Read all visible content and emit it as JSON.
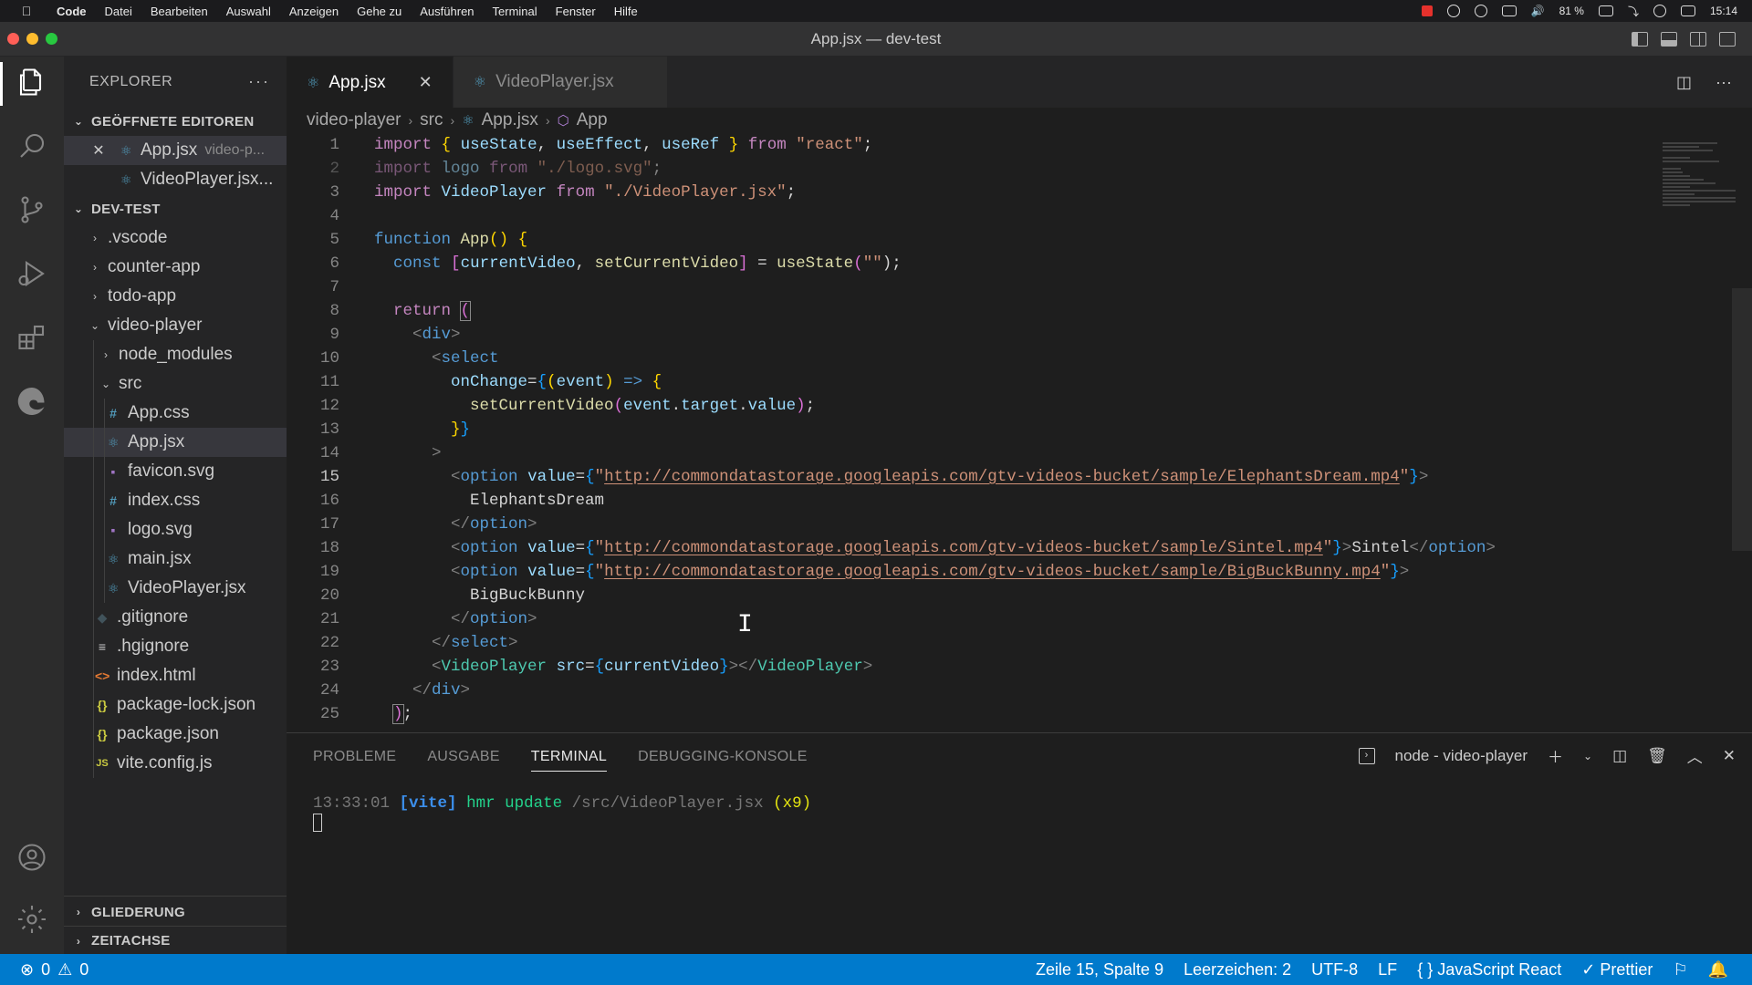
{
  "menubar": {
    "app": "Code",
    "items": [
      "Datei",
      "Bearbeiten",
      "Auswahl",
      "Anzeigen",
      "Gehe zu",
      "Ausführen",
      "Terminal",
      "Fenster",
      "Hilfe"
    ],
    "battery": "81 %",
    "clock": "15:14"
  },
  "window": {
    "title": "App.jsx — dev-test"
  },
  "sidebar": {
    "title": "EXPLORER",
    "open_editors_title": "GEÖFFNETE EDITOREN",
    "open_editors": [
      {
        "name": "App.jsx",
        "hint": "video-p..."
      },
      {
        "name": "VideoPlayer.jsx..."
      }
    ],
    "workspace_title": "DEV-TEST",
    "tree": [
      {
        "name": ".vscode",
        "kind": "folder"
      },
      {
        "name": "counter-app",
        "kind": "folder"
      },
      {
        "name": "todo-app",
        "kind": "folder"
      },
      {
        "name": "video-player",
        "kind": "folder-open"
      },
      {
        "name": "node_modules",
        "kind": "folder"
      },
      {
        "name": "src",
        "kind": "folder-open"
      },
      {
        "name": "App.css",
        "icon": "#"
      },
      {
        "name": "App.jsx",
        "icon": "⚛"
      },
      {
        "name": "favicon.svg",
        "icon": "▪"
      },
      {
        "name": "index.css",
        "icon": "#"
      },
      {
        "name": "logo.svg",
        "icon": "▪"
      },
      {
        "name": "main.jsx",
        "icon": "⚛"
      },
      {
        "name": "VideoPlayer.jsx",
        "icon": "⚛"
      },
      {
        "name": ".gitignore",
        "icon": "◆"
      },
      {
        "name": ".hgignore",
        "icon": "≡"
      },
      {
        "name": "index.html",
        "icon": "<>"
      },
      {
        "name": "package-lock.json",
        "icon": "{}"
      },
      {
        "name": "package.json",
        "icon": "{}"
      },
      {
        "name": "vite.config.js",
        "icon": "JS"
      }
    ],
    "outline_title": "GLIEDERUNG",
    "timeline_title": "ZEITACHSE"
  },
  "editor": {
    "tabs": [
      {
        "label": "App.jsx",
        "active": true
      },
      {
        "label": "VideoPlayer.jsx",
        "active": false
      }
    ],
    "breadcrumb": [
      "video-player",
      "src",
      "App.jsx",
      "App"
    ],
    "current_line": 15,
    "line_numbers": [
      "1",
      "2",
      "3",
      "4",
      "5",
      "6",
      "7",
      "8",
      "9",
      "10",
      "11",
      "12",
      "13",
      "14",
      "15",
      "16",
      "17",
      "18",
      "19",
      "20",
      "21",
      "22",
      "23",
      "24",
      "25"
    ],
    "code": {
      "l1": [
        "import",
        "{",
        "useState",
        ",",
        "useEffect",
        ",",
        "useRef",
        "}",
        "from",
        "\"react\"",
        ";"
      ],
      "l2": [
        "import",
        "logo",
        "from",
        "\"./logo.svg\"",
        ";"
      ],
      "l3": [
        "import",
        "VideoPlayer",
        "from",
        "\"./VideoPlayer.jsx\"",
        ";"
      ],
      "l5": [
        "function",
        "App",
        "(",
        ")",
        "{"
      ],
      "l6": [
        "const",
        "[",
        "currentVideo",
        ", ",
        "setCurrentVideo",
        "]",
        " = ",
        "useState",
        "(",
        "\"\"",
        ");"
      ],
      "l8": [
        "return",
        "("
      ],
      "l9": [
        "<",
        "div",
        ">"
      ],
      "l10": [
        "<",
        "select"
      ],
      "l11": [
        "onChange",
        "=",
        "{",
        "(",
        "event",
        ")",
        "=>",
        "{"
      ],
      "l12": [
        "setCurrentVideo",
        "(",
        "event",
        ".",
        "target",
        ".",
        "value",
        ")",
        ";"
      ],
      "l13": [
        "}",
        "}"
      ],
      "l14": [
        ">"
      ],
      "l15": [
        "option",
        "value",
        "=",
        "{",
        "\"",
        "http://commondatastorage.googleapis.com/gtv-videos-bucket/sample/ElephantsDream.mp4",
        "\"",
        "}",
        ">"
      ],
      "l16": [
        "ElephantsDream"
      ],
      "l17": [
        "</",
        "option",
        ">"
      ],
      "l18": [
        "<",
        "option",
        "value",
        "=",
        "{",
        "\"",
        "http://commondatastorage.googleapis.com/gtv-videos-bucket/sample/Sintel.mp4",
        "\"",
        "}",
        ">",
        "Sintel",
        "</",
        "option",
        ">"
      ],
      "l19": [
        "<",
        "option",
        "value",
        "=",
        "{",
        "\"",
        "http://commondatastorage.googleapis.com/gtv-videos-bucket/sample/BigBuckBunny.mp4",
        "\"",
        "}",
        ">"
      ],
      "l20": [
        "BigBuckBunny"
      ],
      "l21": [
        "</",
        "option",
        ">"
      ],
      "l22": [
        "</",
        "select",
        ">"
      ],
      "l23": [
        "<",
        "VideoPlayer",
        "src",
        "=",
        "{",
        "currentVideo",
        "}",
        "></",
        "VideoPlayer",
        ">"
      ],
      "l24": [
        "</",
        "div",
        ">"
      ],
      "l25": [
        ")",
        ";"
      ]
    }
  },
  "panel": {
    "tabs": [
      "PROBLEME",
      "AUSGABE",
      "TERMINAL",
      "DEBUGGING-KONSOLE"
    ],
    "active_tab": "TERMINAL",
    "terminal_name": "node - video-player",
    "terminal": {
      "time": "13:33:01",
      "tag": "[vite]",
      "msg": "hmr update",
      "path": "/src/VideoPlayer.jsx",
      "count": "(x9)"
    }
  },
  "statusbar": {
    "errors": "0",
    "warnings": "0",
    "position": "Zeile 15, Spalte 9",
    "indent": "Leerzeichen: 2",
    "encoding": "UTF-8",
    "eol": "LF",
    "language": "JavaScript React",
    "formatter": "Prettier"
  },
  "colors": {
    "statusbar": "#007acc",
    "accent": "#519aba"
  }
}
